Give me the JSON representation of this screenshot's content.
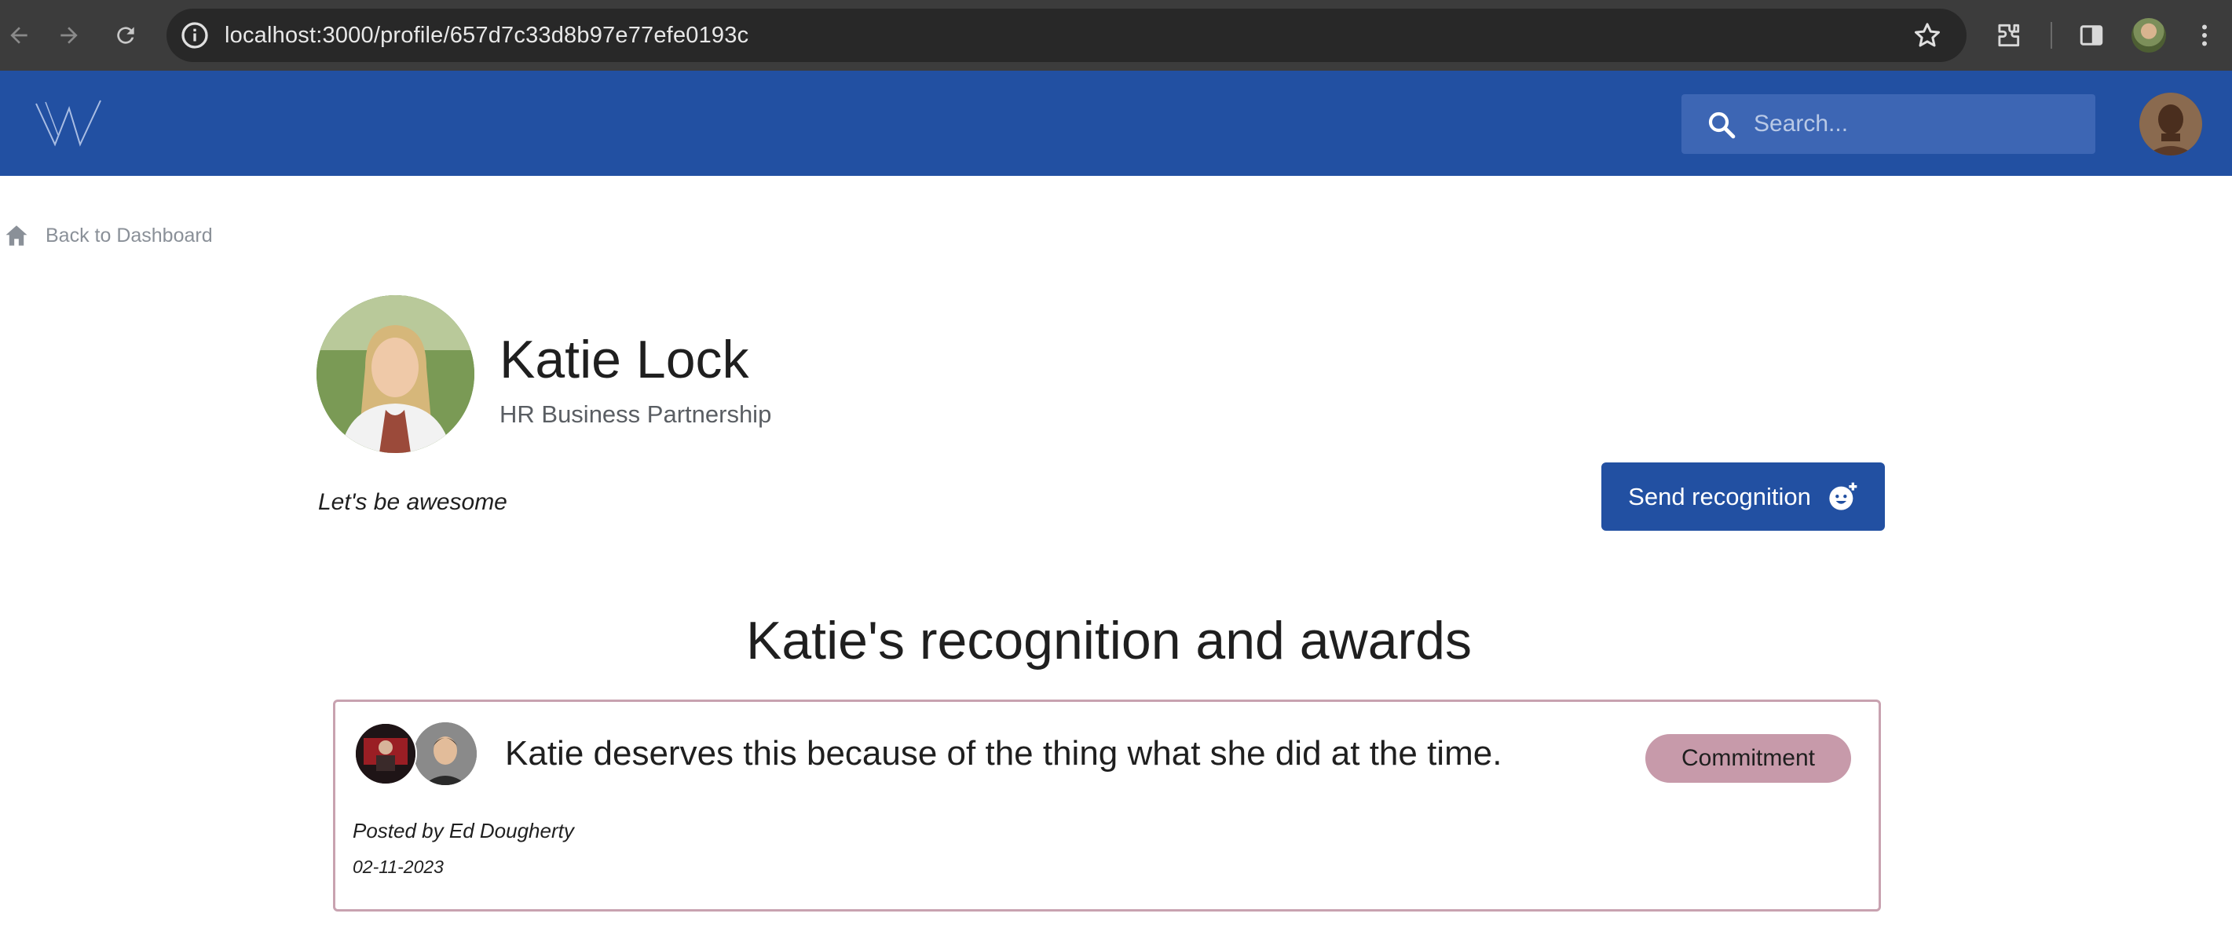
{
  "browser": {
    "url": "localhost:3000/profile/657d7c33d8b97e77efe0193c",
    "icons": [
      "back-arrow-icon",
      "forward-arrow-icon",
      "reload-icon",
      "site-info-icon",
      "star-icon",
      "extensions-icon",
      "side-panel-icon",
      "kebab-menu-icon"
    ]
  },
  "header": {
    "logo_icon": "w-logo-icon",
    "search_placeholder": "Search...",
    "search_icon": "search-icon",
    "brand_color": "#2250a2"
  },
  "breadcrumb": {
    "icon": "home-icon",
    "label": "Back to Dashboard"
  },
  "profile": {
    "name": "Katie Lock",
    "department": "HR Business Partnership",
    "tagline": "Let's be awesome"
  },
  "actions": {
    "send_recognition_label": "Send recognition",
    "send_recognition_icon": "smiley-add-icon"
  },
  "recognitions": {
    "title": "Katie's recognition and awards",
    "items": [
      {
        "message": "Katie deserves this because of the thing what she did at the time.",
        "value": "Commitment",
        "value_color": "#c79aaa",
        "posted_by": "Posted by Ed Dougherty",
        "date": "02-11-2023"
      }
    ]
  }
}
